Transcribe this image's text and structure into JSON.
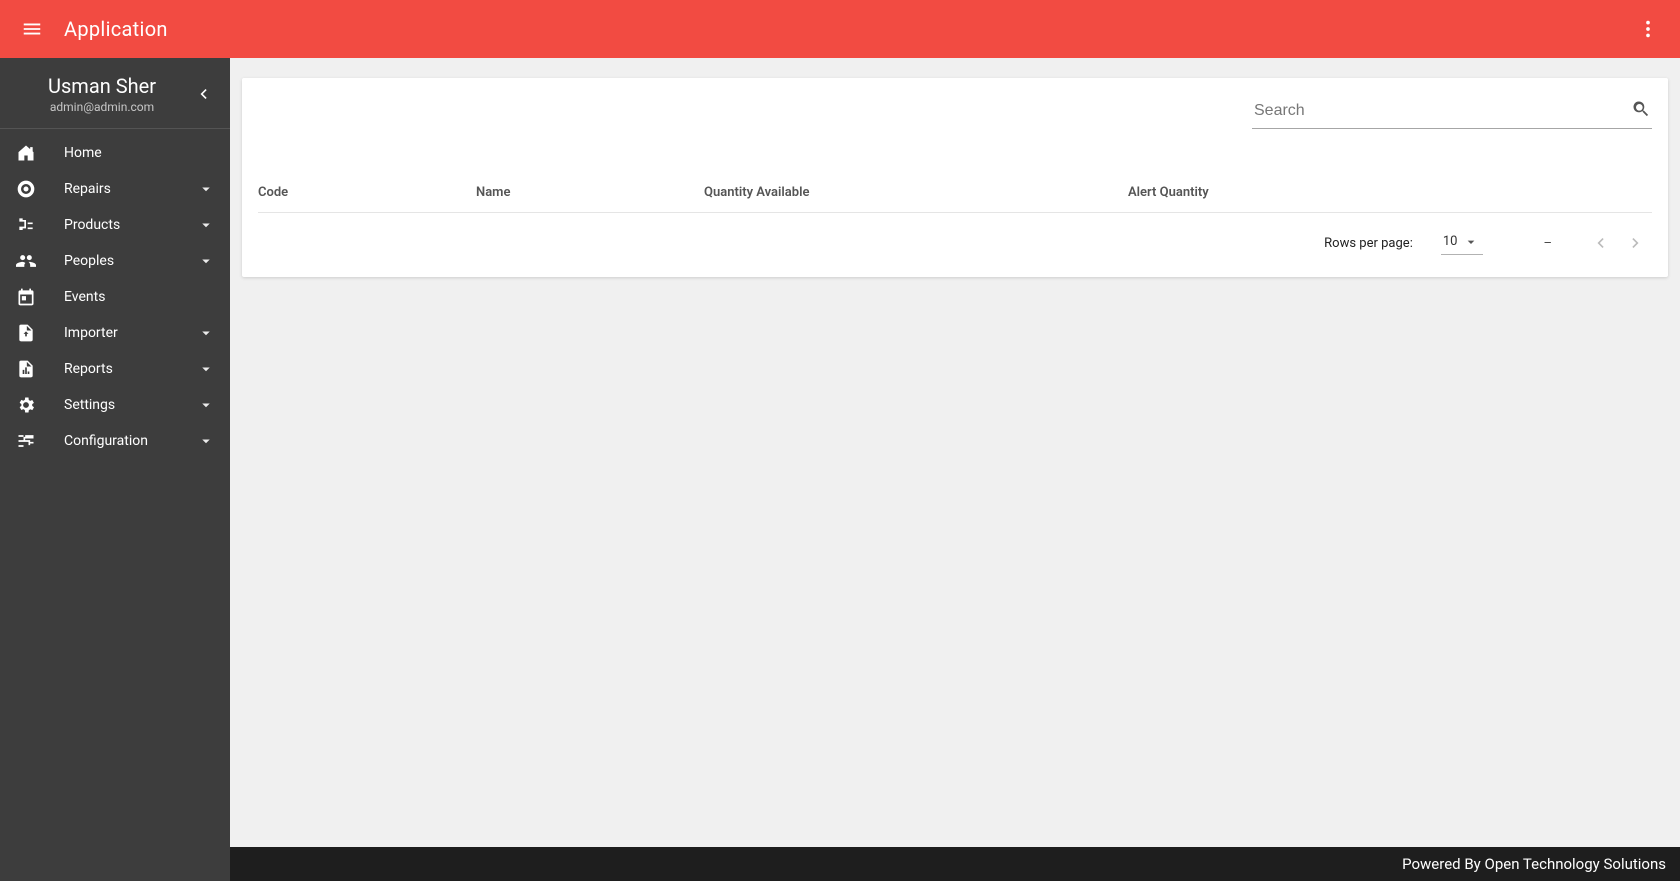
{
  "appbar": {
    "title": "Application"
  },
  "user": {
    "name": "Usman Sher",
    "email": "admin@admin.com"
  },
  "sidebar": {
    "items": [
      {
        "icon": "home",
        "label": "Home",
        "expandable": false
      },
      {
        "icon": "lifebuoy",
        "label": "Repairs",
        "expandable": true
      },
      {
        "icon": "tree",
        "label": "Products",
        "expandable": true
      },
      {
        "icon": "people",
        "label": "Peoples",
        "expandable": true
      },
      {
        "icon": "event",
        "label": "Events",
        "expandable": false
      },
      {
        "icon": "file",
        "label": "Importer",
        "expandable": true
      },
      {
        "icon": "report",
        "label": "Reports",
        "expandable": true
      },
      {
        "icon": "gear",
        "label": "Settings",
        "expandable": true
      },
      {
        "icon": "tune",
        "label": "Configuration",
        "expandable": true
      }
    ]
  },
  "search": {
    "placeholder": "Search",
    "value": ""
  },
  "table": {
    "columns": [
      "Code",
      "Name",
      "Quantity Available",
      "Alert Quantity"
    ],
    "rows": []
  },
  "pagination": {
    "rows_per_page_label": "Rows per page:",
    "rows_per_page_value": "10",
    "range_text": "–"
  },
  "footer": {
    "text": "Powered By Open Technology Solutions"
  }
}
